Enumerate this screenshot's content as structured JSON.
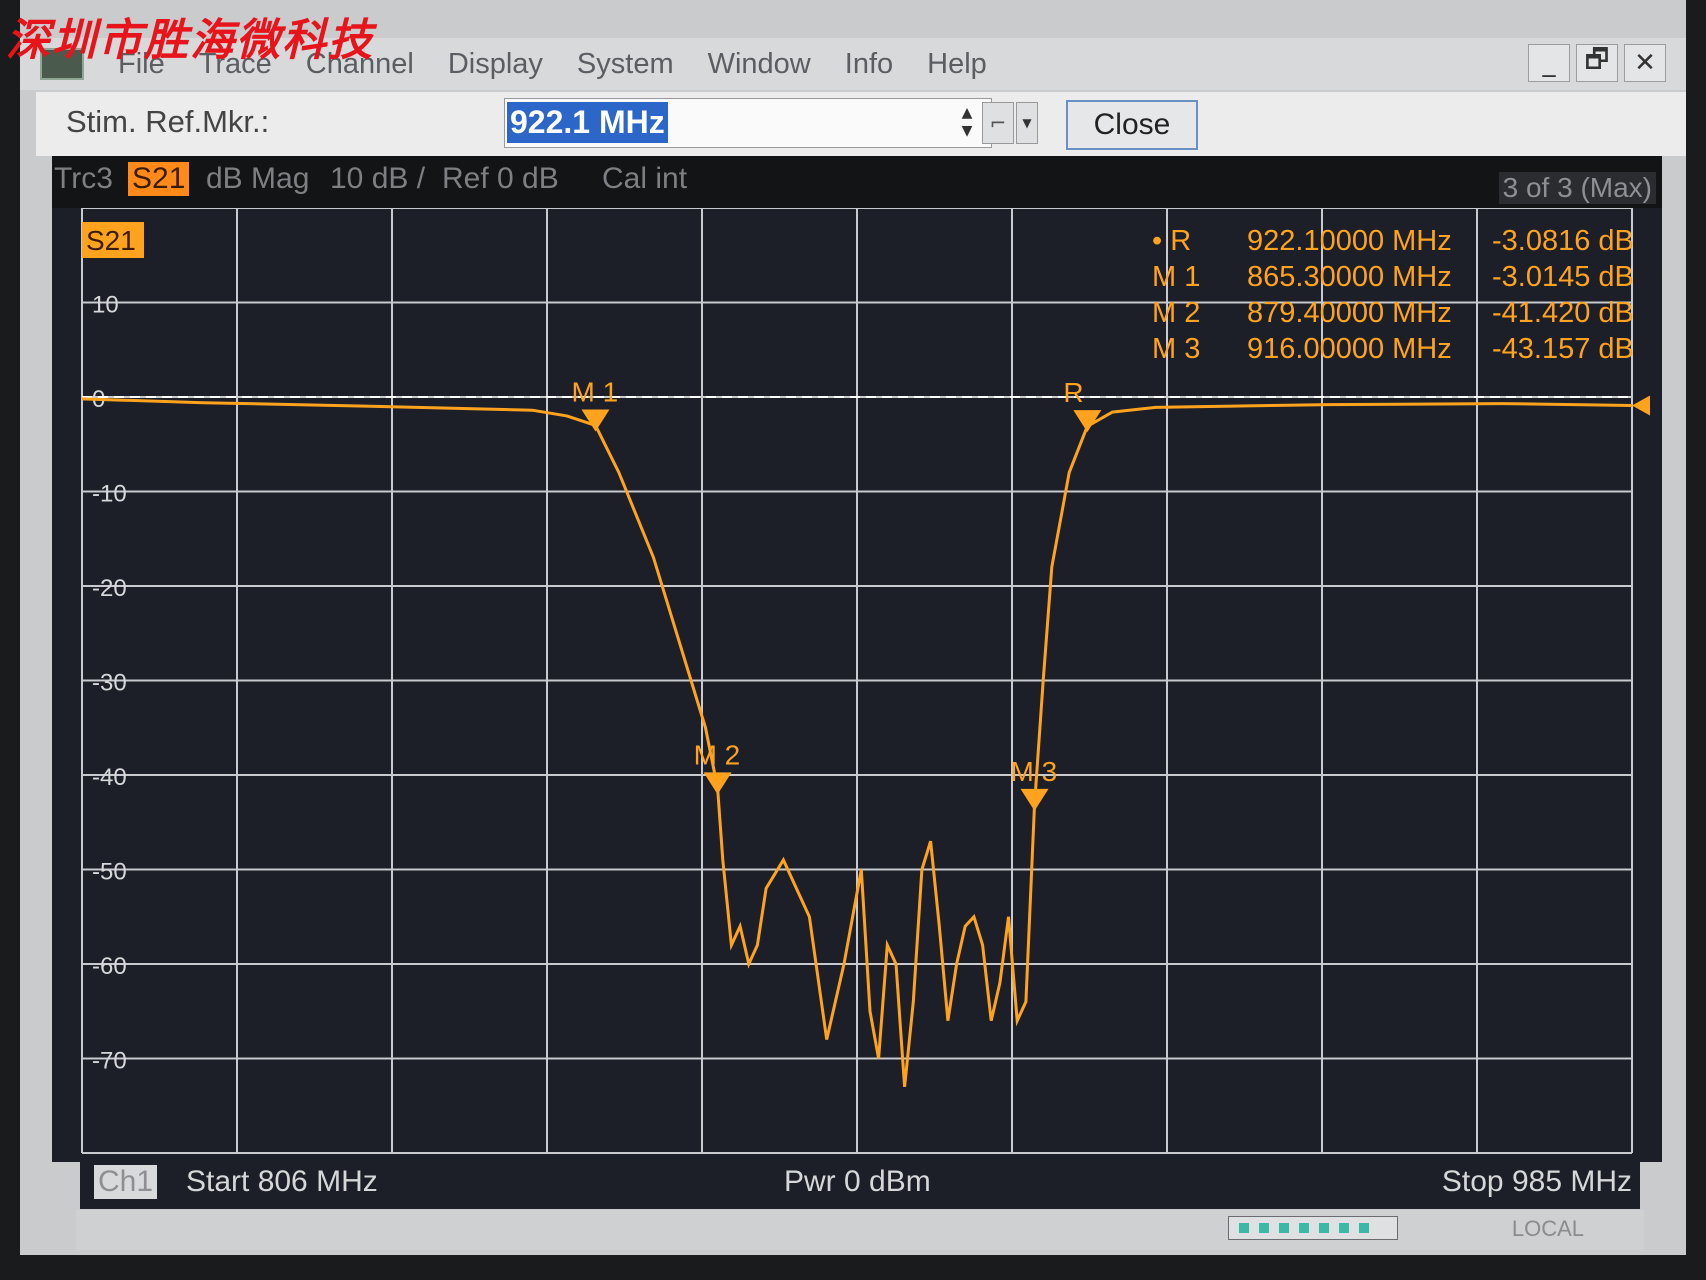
{
  "watermark": "深圳市胜海微科技",
  "menu": [
    "File",
    "Trace",
    "Channel",
    "Display",
    "System",
    "Window",
    "Info",
    "Help"
  ],
  "window_buttons": [
    "_",
    "🗗",
    "✕"
  ],
  "toolbar": {
    "stim_label": "Stim. Ref.Mkr.:",
    "stim_value": "922.1 MHz",
    "close_label": "Close"
  },
  "trace_bar": {
    "trace": "Trc3",
    "param": "S21",
    "format": "dB Mag",
    "scale": "10 dB /",
    "ref": "Ref 0 dB",
    "cal": "Cal int",
    "count": "3 of 3 (Max)"
  },
  "bottom": {
    "channel": "Ch1",
    "start": "Start  806 MHz",
    "power": "Pwr  0 dBm",
    "stop": "Stop  985 MHz"
  },
  "status": {
    "local": "LOCAL"
  },
  "chart_data": {
    "type": "line",
    "trace_label": "S21",
    "x_range_mhz": [
      806,
      985
    ],
    "ylim": [
      -80,
      20
    ],
    "y_ticks": [
      10,
      0,
      -10,
      -20,
      -30,
      -40,
      -50,
      -60,
      -70
    ],
    "x_divisions": 10,
    "ref_line_db": 0,
    "grid": true,
    "colors": {
      "trace": "#ffa31f",
      "grid": "#c8cad0",
      "background": "#1d1f28",
      "ref_line": "#ffffff"
    },
    "series": [
      {
        "x": [
          806,
          820,
          840,
          858,
          862,
          865.3,
          868,
          872,
          875,
          878,
          879.4,
          880,
          881,
          882,
          883,
          884,
          885,
          887,
          890,
          892,
          894,
          896,
          897,
          898,
          899,
          900,
          901,
          902,
          903,
          904,
          905,
          906,
          907,
          908,
          909,
          910,
          911,
          912,
          913,
          914,
          915,
          916,
          917,
          918,
          920,
          922.1,
          925,
          930,
          950,
          970,
          985
        ],
        "y": [
          -0.2,
          -0.6,
          -1.0,
          -1.4,
          -2.0,
          -3.0,
          -8,
          -17,
          -26,
          -35,
          -41.4,
          -49,
          -58,
          -56,
          -60,
          -58,
          -52,
          -49,
          -55,
          -68,
          -60,
          -50,
          -65,
          -70,
          -58,
          -60,
          -73,
          -64,
          -50,
          -47,
          -56,
          -66,
          -60,
          -56,
          -55,
          -58,
          -66,
          -62,
          -55,
          -66,
          -64,
          -43.2,
          -30,
          -18,
          -8,
          -3.1,
          -1.6,
          -1.1,
          -0.8,
          -0.7,
          -0.9
        ]
      }
    ],
    "markers": [
      {
        "label": "M 1",
        "freq_mhz": 865.3,
        "value_db": -3.0145,
        "readout": "865.30000 MHz",
        "value": "-3.0145 dB"
      },
      {
        "label": "M 2",
        "freq_mhz": 879.4,
        "value_db": -41.42,
        "readout": "879.40000 MHz",
        "value": "-41.420 dB"
      },
      {
        "label": "M 3",
        "freq_mhz": 916.0,
        "value_db": -43.157,
        "readout": "916.00000 MHz",
        "value": "-43.157 dB"
      },
      {
        "label": "R",
        "freq_mhz": 922.1,
        "value_db": -3.0816,
        "readout": "922.10000 MHz",
        "value": "-3.0816 dB"
      }
    ],
    "marker_table": [
      {
        "name": "• R",
        "freq": "922.10000 MHz",
        "value": "-3.0816 dB"
      },
      {
        "name": "M 1",
        "freq": "865.30000 MHz",
        "value": "-3.0145 dB"
      },
      {
        "name": "M 2",
        "freq": "879.40000 MHz",
        "value": "-41.420 dB"
      },
      {
        "name": "M 3",
        "freq": "916.00000 MHz",
        "value": "-43.157 dB"
      }
    ]
  }
}
